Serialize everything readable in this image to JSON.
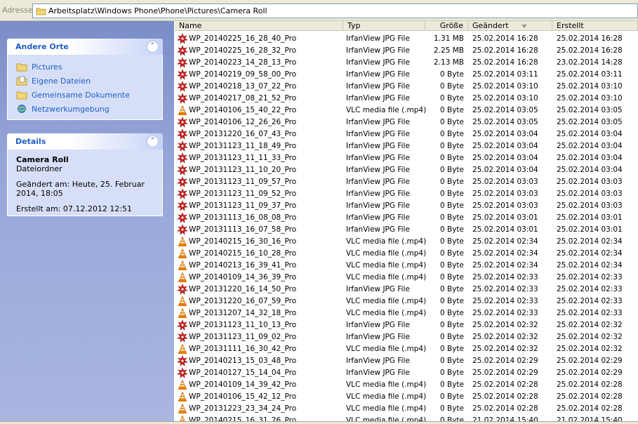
{
  "address": {
    "label": "Adresse",
    "path": "Arbeitsplatz\\Windows Phone\\Phone\\Pictures\\Camera Roll"
  },
  "panels": {
    "orte": {
      "title": "Andere Orte",
      "items": [
        {
          "label": "Pictures",
          "icon": "folder-icon"
        },
        {
          "label": "Eigene Dateien",
          "icon": "my-documents-icon"
        },
        {
          "label": "Gemeinsame Dokumente",
          "icon": "folder-icon"
        },
        {
          "label": "Netzwerkumgebung",
          "icon": "network-icon"
        }
      ]
    },
    "details": {
      "title": "Details",
      "name": "Camera Roll",
      "kind": "Dateiordner",
      "modified": "Geändert am: Heute, 25. Februar 2014, 18:05",
      "created": "Erstellt am: 07.12.2012 12:51"
    }
  },
  "columns": {
    "name": "Name",
    "type": "Typ",
    "size": "Größe",
    "modified": "Geändert",
    "created": "Erstellt"
  },
  "files": [
    {
      "name": "WP_20140225_16_28_40_Pro",
      "type": "IrfanView JPG File",
      "size": "1.31 MB",
      "modified": "25.02.2014 16:28",
      "created": "25.02.2014 16:28",
      "icon": "irfanview-icon"
    },
    {
      "name": "WP_20140225_16_28_32_Pro",
      "type": "IrfanView JPG File",
      "size": "2.25 MB",
      "modified": "25.02.2014 16:28",
      "created": "25.02.2014 16:28",
      "icon": "irfanview-icon"
    },
    {
      "name": "WP_20140223_14_28_13_Pro",
      "type": "IrfanView JPG File",
      "size": "2.13 MB",
      "modified": "25.02.2014 16:28",
      "created": "23.02.2014 14:28",
      "icon": "irfanview-icon"
    },
    {
      "name": "WP_20140219_09_58_00_Pro",
      "type": "IrfanView JPG File",
      "size": "0 Byte",
      "modified": "25.02.2014 03:11",
      "created": "25.02.2014 03:11",
      "icon": "irfanview-icon"
    },
    {
      "name": "WP_20140218_13_07_22_Pro",
      "type": "IrfanView JPG File",
      "size": "0 Byte",
      "modified": "25.02.2014 03:10",
      "created": "25.02.2014 03:10",
      "icon": "irfanview-icon"
    },
    {
      "name": "WP_20140217_08_21_52_Pro",
      "type": "IrfanView JPG File",
      "size": "0 Byte",
      "modified": "25.02.2014 03:10",
      "created": "25.02.2014 03:10",
      "icon": "irfanview-icon"
    },
    {
      "name": "WP_20140106_15_40_22_Pro",
      "type": "VLC media file (.mp4)",
      "size": "0 Byte",
      "modified": "25.02.2014 03:05",
      "created": "25.02.2014 03:05",
      "icon": "vlc-cone-icon"
    },
    {
      "name": "WP_20140106_12_26_26_Pro",
      "type": "IrfanView JPG File",
      "size": "0 Byte",
      "modified": "25.02.2014 03:05",
      "created": "25.02.2014 03:05",
      "icon": "irfanview-icon"
    },
    {
      "name": "WP_20131220_16_07_43_Pro",
      "type": "IrfanView JPG File",
      "size": "0 Byte",
      "modified": "25.02.2014 03:04",
      "created": "25.02.2014 03:04",
      "icon": "irfanview-icon"
    },
    {
      "name": "WP_20131123_11_18_49_Pro",
      "type": "IrfanView JPG File",
      "size": "0 Byte",
      "modified": "25.02.2014 03:04",
      "created": "25.02.2014 03:04",
      "icon": "irfanview-icon"
    },
    {
      "name": "WP_20131123_11_11_33_Pro",
      "type": "IrfanView JPG File",
      "size": "0 Byte",
      "modified": "25.02.2014 03:04",
      "created": "25.02.2014 03:04",
      "icon": "irfanview-icon"
    },
    {
      "name": "WP_20131123_11_10_20_Pro",
      "type": "IrfanView JPG File",
      "size": "0 Byte",
      "modified": "25.02.2014 03:04",
      "created": "25.02.2014 03:04",
      "icon": "irfanview-icon"
    },
    {
      "name": "WP_20131123_11_09_57_Pro",
      "type": "IrfanView JPG File",
      "size": "0 Byte",
      "modified": "25.02.2014 03:03",
      "created": "25.02.2014 03:03",
      "icon": "irfanview-icon"
    },
    {
      "name": "WP_20131123_11_09_52_Pro",
      "type": "IrfanView JPG File",
      "size": "0 Byte",
      "modified": "25.02.2014 03:03",
      "created": "25.02.2014 03:03",
      "icon": "irfanview-icon"
    },
    {
      "name": "WP_20131123_11_09_37_Pro",
      "type": "IrfanView JPG File",
      "size": "0 Byte",
      "modified": "25.02.2014 03:03",
      "created": "25.02.2014 03:03",
      "icon": "irfanview-icon"
    },
    {
      "name": "WP_20131113_16_08_08_Pro",
      "type": "IrfanView JPG File",
      "size": "0 Byte",
      "modified": "25.02.2014 03:01",
      "created": "25.02.2014 03:01",
      "icon": "irfanview-icon"
    },
    {
      "name": "WP_20131113_16_07_58_Pro",
      "type": "IrfanView JPG File",
      "size": "0 Byte",
      "modified": "25.02.2014 03:01",
      "created": "25.02.2014 03:01",
      "icon": "irfanview-icon"
    },
    {
      "name": "WP_20140215_16_30_16_Pro",
      "type": "VLC media file (.mp4)",
      "size": "0 Byte",
      "modified": "25.02.2014 02:34",
      "created": "25.02.2014 02:34",
      "icon": "vlc-cone-icon"
    },
    {
      "name": "WP_20140215_16_10_28_Pro",
      "type": "VLC media file (.mp4)",
      "size": "0 Byte",
      "modified": "25.02.2014 02:34",
      "created": "25.02.2014 02:34",
      "icon": "vlc-cone-icon"
    },
    {
      "name": "WP_20140213_16_39_41_Pro",
      "type": "VLC media file (.mp4)",
      "size": "0 Byte",
      "modified": "25.02.2014 02:34",
      "created": "25.02.2014 02:34",
      "icon": "vlc-cone-icon"
    },
    {
      "name": "WP_20140109_14_36_39_Pro",
      "type": "VLC media file (.mp4)",
      "size": "0 Byte",
      "modified": "25.02.2014 02:33",
      "created": "25.02.2014 02:33",
      "icon": "vlc-cone-icon"
    },
    {
      "name": "WP_20131220_16_14_50_Pro",
      "type": "IrfanView JPG File",
      "size": "0 Byte",
      "modified": "25.02.2014 02:33",
      "created": "25.02.2014 02:33",
      "icon": "irfanview-icon"
    },
    {
      "name": "WP_20131220_16_07_59_Pro",
      "type": "VLC media file (.mp4)",
      "size": "0 Byte",
      "modified": "25.02.2014 02:33",
      "created": "25.02.2014 02:33",
      "icon": "vlc-cone-icon"
    },
    {
      "name": "WP_20131207_14_32_18_Pro",
      "type": "VLC media file (.mp4)",
      "size": "0 Byte",
      "modified": "25.02.2014 02:33",
      "created": "25.02.2014 02:33",
      "icon": "vlc-cone-icon"
    },
    {
      "name": "WP_20131123_11_10_13_Pro",
      "type": "IrfanView JPG File",
      "size": "0 Byte",
      "modified": "25.02.2014 02:32",
      "created": "25.02.2014 02:32",
      "icon": "irfanview-icon"
    },
    {
      "name": "WP_20131123_11_09_02_Pro",
      "type": "IrfanView JPG File",
      "size": "0 Byte",
      "modified": "25.02.2014 02:32",
      "created": "25.02.2014 02:32",
      "icon": "irfanview-icon"
    },
    {
      "name": "WP_20131111_16_30_42_Pro",
      "type": "VLC media file (.mp4)",
      "size": "0 Byte",
      "modified": "25.02.2014 02:32",
      "created": "25.02.2014 02:32",
      "icon": "vlc-cone-icon"
    },
    {
      "name": "WP_20140213_15_03_48_Pro",
      "type": "IrfanView JPG File",
      "size": "0 Byte",
      "modified": "25.02.2014 02:29",
      "created": "25.02.2014 02:29",
      "icon": "irfanview-icon"
    },
    {
      "name": "WP_20140127_15_14_04_Pro",
      "type": "IrfanView JPG File",
      "size": "0 Byte",
      "modified": "25.02.2014 02:29",
      "created": "25.02.2014 02:29",
      "icon": "irfanview-icon"
    },
    {
      "name": "WP_20140109_14_39_42_Pro",
      "type": "VLC media file (.mp4)",
      "size": "0 Byte",
      "modified": "25.02.2014 02:28",
      "created": "25.02.2014 02:28",
      "icon": "vlc-cone-icon"
    },
    {
      "name": "WP_20140106_15_42_12_Pro",
      "type": "VLC media file (.mp4)",
      "size": "0 Byte",
      "modified": "25.02.2014 02:28",
      "created": "25.02.2014 02:28",
      "icon": "vlc-cone-icon"
    },
    {
      "name": "WP_20131223_23_34_24_Pro",
      "type": "VLC media file (.mp4)",
      "size": "0 Byte",
      "modified": "25.02.2014 02:28",
      "created": "25.02.2014 02:28",
      "icon": "vlc-cone-icon"
    },
    {
      "name": "WP_20140215_16_31_26_Pro",
      "type": "VLC media file (.mp4)",
      "size": "0 Byte",
      "modified": "21.02.2014 15:40",
      "created": "21.02.2014 15:40",
      "icon": "vlc-cone-icon"
    }
  ]
}
